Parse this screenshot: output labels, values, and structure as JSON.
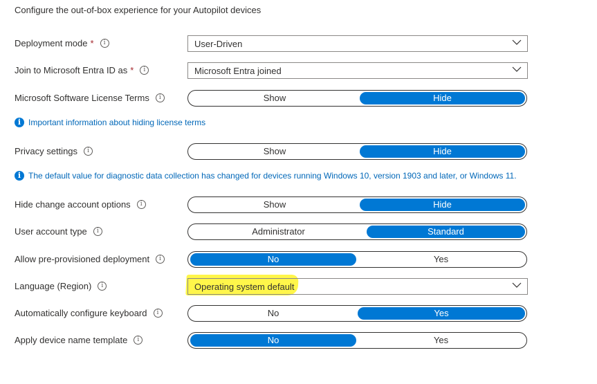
{
  "heading": "Configure the out-of-box experience for your Autopilot devices",
  "rows": {
    "deployment_mode": {
      "label": "Deployment mode",
      "required": "*",
      "value": "User-Driven"
    },
    "join_entra": {
      "label": "Join to Microsoft Entra ID as",
      "required": "*",
      "value": "Microsoft Entra joined"
    },
    "license_terms": {
      "label": "Microsoft Software License Terms",
      "options": [
        "Show",
        "Hide"
      ],
      "selected": "Hide"
    },
    "license_info": "Important information about hiding license terms",
    "privacy": {
      "label": "Privacy settings",
      "options": [
        "Show",
        "Hide"
      ],
      "selected": "Hide"
    },
    "privacy_info": "The default value for diagnostic data collection has changed for devices running Windows 10, version 1903 and later, or Windows 11.",
    "hide_change_account": {
      "label": "Hide change account options",
      "options": [
        "Show",
        "Hide"
      ],
      "selected": "Hide"
    },
    "user_account_type": {
      "label": "User account type",
      "options": [
        "Administrator",
        "Standard"
      ],
      "selected": "Standard"
    },
    "pre_provisioned": {
      "label": "Allow pre-provisioned deployment",
      "options": [
        "No",
        "Yes"
      ],
      "selected": "No"
    },
    "language": {
      "label": "Language (Region)",
      "value": "Operating system default"
    },
    "auto_keyboard": {
      "label": "Automatically configure keyboard",
      "options": [
        "No",
        "Yes"
      ],
      "selected": "Yes"
    },
    "device_name_template": {
      "label": "Apply device name template",
      "options": [
        "No",
        "Yes"
      ],
      "selected": "No"
    }
  },
  "info_icon_glyph": "i",
  "accent_color": "#0078d4",
  "highlight_color": "#fff200"
}
